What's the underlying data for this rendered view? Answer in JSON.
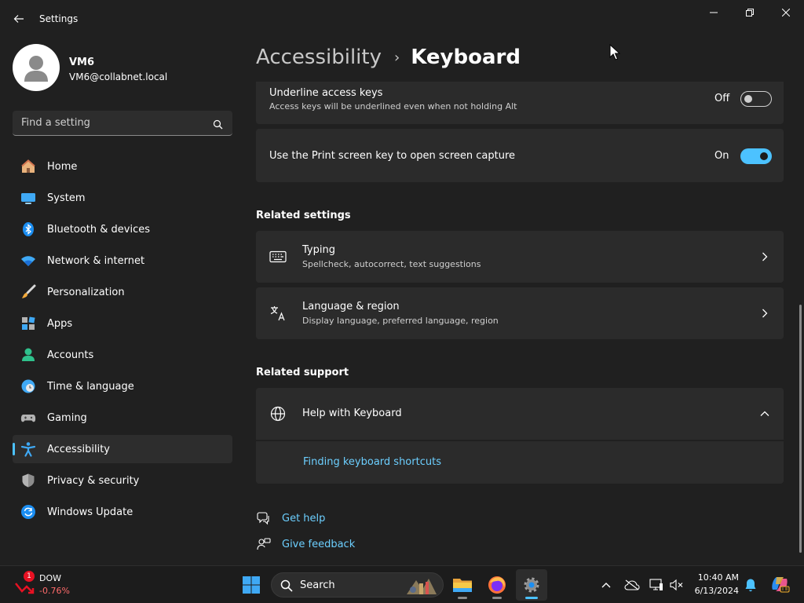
{
  "window": {
    "app_title": "Settings"
  },
  "profile": {
    "name": "VM6",
    "email": "VM6@collabnet.local"
  },
  "search": {
    "placeholder": "Find a setting"
  },
  "sidebar": {
    "items": [
      {
        "label": "Home",
        "icon": "home-icon"
      },
      {
        "label": "System",
        "icon": "system-icon"
      },
      {
        "label": "Bluetooth & devices",
        "icon": "bluetooth-icon"
      },
      {
        "label": "Network & internet",
        "icon": "wifi-icon"
      },
      {
        "label": "Personalization",
        "icon": "brush-icon"
      },
      {
        "label": "Apps",
        "icon": "apps-icon"
      },
      {
        "label": "Accounts",
        "icon": "accounts-icon"
      },
      {
        "label": "Time & language",
        "icon": "clock-globe-icon"
      },
      {
        "label": "Gaming",
        "icon": "gamepad-icon"
      },
      {
        "label": "Accessibility",
        "icon": "accessibility-icon",
        "active": true
      },
      {
        "label": "Privacy & security",
        "icon": "shield-icon"
      },
      {
        "label": "Windows Update",
        "icon": "update-icon"
      }
    ]
  },
  "breadcrumb": {
    "parent": "Accessibility",
    "separator": "›",
    "current": "Keyboard"
  },
  "settings": {
    "underline_keys": {
      "title": "Underline access keys",
      "description": "Access keys will be underlined even when not holding Alt",
      "state_label": "Off"
    },
    "print_screen": {
      "title": "Use the Print screen key to open screen capture",
      "state_label": "On"
    }
  },
  "related_settings": {
    "heading": "Related settings",
    "items": [
      {
        "title": "Typing",
        "description": "Spellcheck, autocorrect, text suggestions",
        "icon": "keyboard-icon"
      },
      {
        "title": "Language & region",
        "description": "Display language, preferred language, region",
        "icon": "language-icon"
      }
    ]
  },
  "related_support": {
    "heading": "Related support",
    "help_title": "Help with Keyboard",
    "help_link": "Finding keyboard shortcuts"
  },
  "footer_links": {
    "get_help": "Get help",
    "give_feedback": "Give feedback"
  },
  "taskbar": {
    "stock_name": "DOW",
    "stock_change": "-0.76%",
    "stock_badge": "1",
    "search_label": "Search",
    "time": "10:40 AM",
    "date": "6/13/2024"
  },
  "colors": {
    "accent": "#4cc2ff",
    "link": "#6ccfff",
    "background": "#202020",
    "card": "#2b2b2b"
  }
}
